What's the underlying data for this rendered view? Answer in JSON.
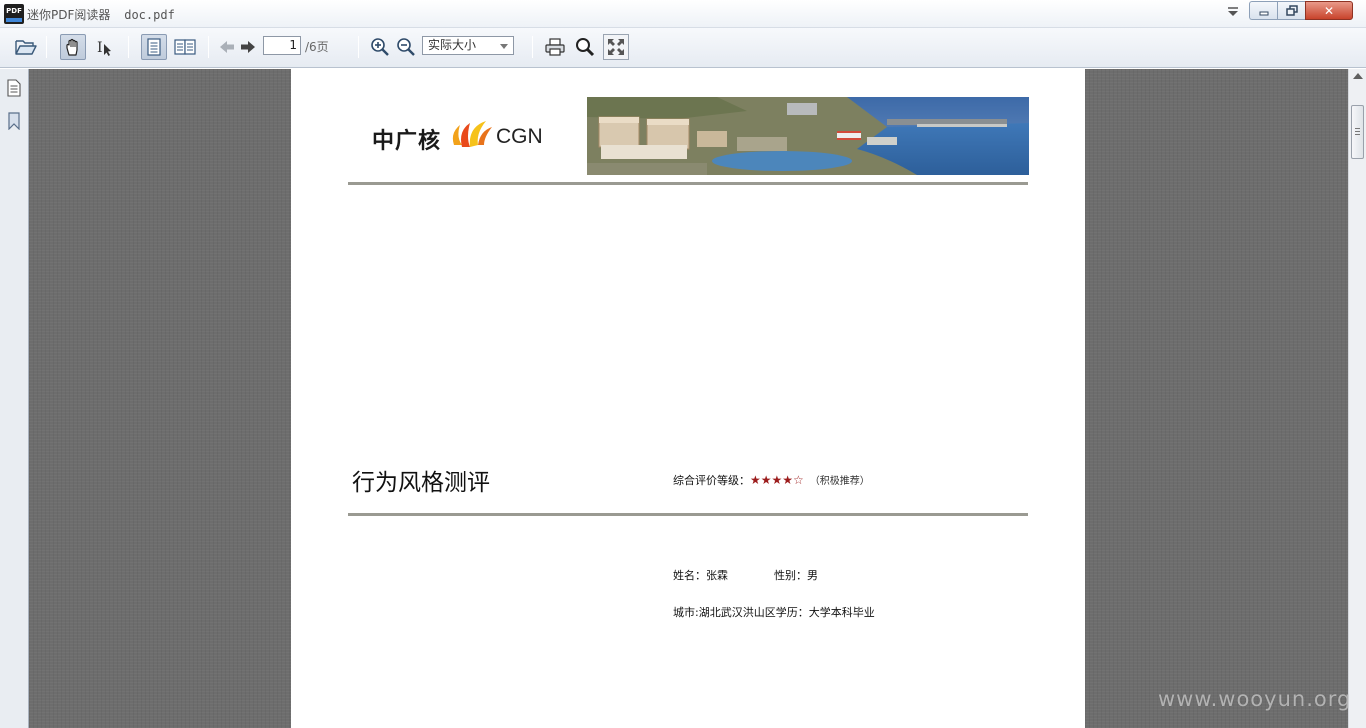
{
  "window": {
    "app_name": "迷你PDF阅读器",
    "file_name": "doc.pdf",
    "app_icon_text": "PDF",
    "close_glyph": "✕"
  },
  "toolbar": {
    "icons": [
      "open-folder-icon",
      "hand-tool-icon",
      "text-select-icon",
      "single-page-icon",
      "two-page-icon",
      "previous-page-icon",
      "next-page-icon",
      "zoom-in-icon",
      "zoom-out-icon",
      "print-icon",
      "search-icon",
      "fullscreen-icon"
    ],
    "current_page": "1",
    "total_pages_label": "/6页",
    "zoom_value": "实际大小"
  },
  "sidebar": {
    "icons": [
      "page-thumbnails-icon",
      "bookmarks-icon"
    ]
  },
  "document": {
    "logo_cn": "中广核",
    "logo_en": "CGN",
    "title": "行为风格测评",
    "rating_label": "综合评价等级：",
    "rating_stars": "★★★★☆",
    "rating_note": "（积极推荐）",
    "rating_value": 4,
    "rating_max": 5,
    "name_field": "姓名：张霖",
    "gender_field": "性别：男",
    "city_field": "城市:湖北武汉洪山区学历：大学本科毕业"
  },
  "watermark": "www.wooyun.org",
  "colors": {
    "viewer_background": "#6d6d6d",
    "stars": "#9c1c1c",
    "rule": "#9a9a92",
    "close_button": "#c8432c"
  }
}
